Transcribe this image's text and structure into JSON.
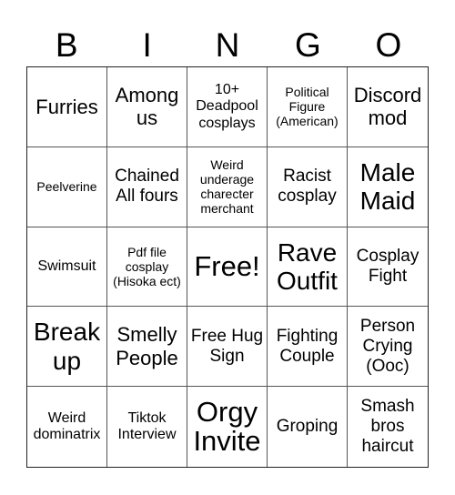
{
  "header": {
    "letters": [
      "B",
      "I",
      "N",
      "G",
      "O"
    ]
  },
  "cells": [
    [
      "Furries",
      "Among us",
      "10+ Deadpool cosplays",
      "Political Figure (American)",
      "Discord mod"
    ],
    [
      "Peelverine",
      "Chained All fours",
      "Weird underage charecter merchant",
      "Racist cosplay",
      "Male Maid"
    ],
    [
      "Swimsuit",
      "Pdf file cosplay (Hisoka ect)",
      "Free!",
      "Rave Outfit",
      "Cosplay Fight"
    ],
    [
      "Break up",
      "Smelly People",
      "Free Hug Sign",
      "Fighting Couple",
      "Person Crying (Ooc)"
    ],
    [
      "Weird dominatrix",
      "Tiktok Interview",
      "Orgy Invite",
      "Groping",
      "Smash bros haircut"
    ]
  ],
  "free_space": "Free!"
}
